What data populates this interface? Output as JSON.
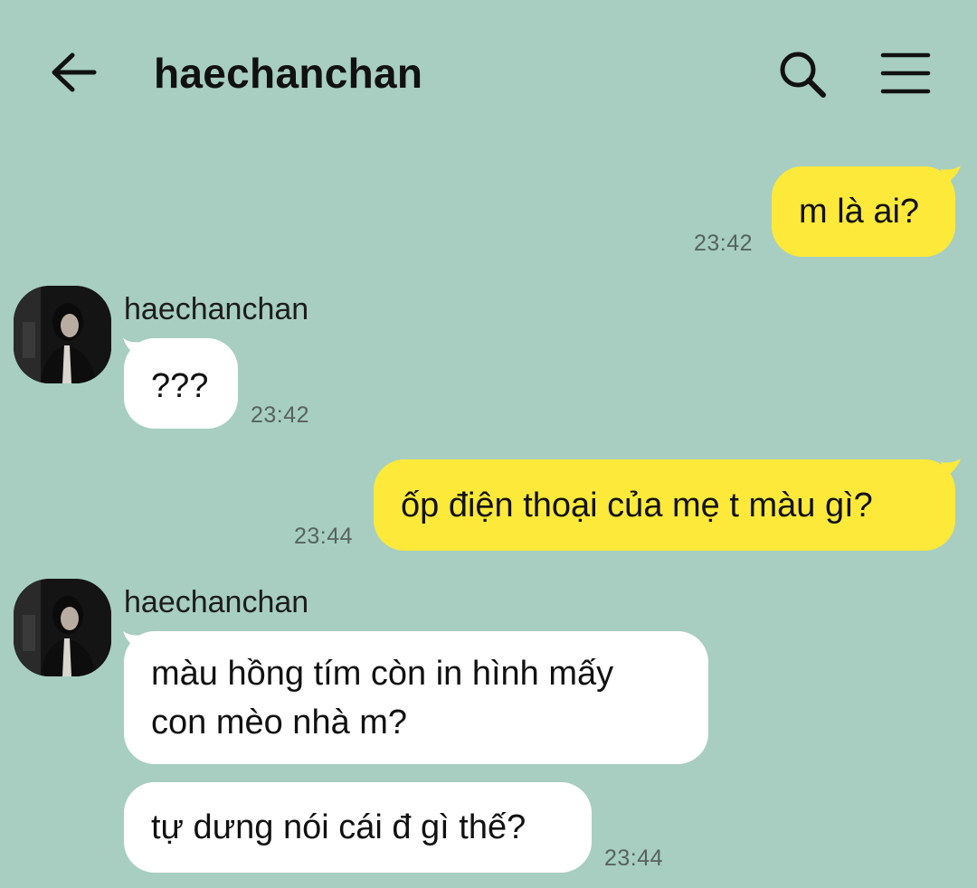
{
  "header": {
    "title": "haechanchan",
    "back_icon": "arrow-left-icon",
    "search_icon": "search-icon",
    "menu_icon": "hamburger-menu-icon"
  },
  "colors": {
    "background": "#a7cec1",
    "my_bubble": "#fde93a",
    "their_bubble": "#ffffff",
    "timestamp": "#56635e"
  },
  "messages": [
    {
      "from": "me",
      "text": "m là ai?",
      "time": "23:42"
    },
    {
      "from": "haechanchan",
      "sender": "haechanchan",
      "text": "???",
      "time": "23:42"
    },
    {
      "from": "me",
      "text": "ốp điện thoại của mẹ t màu gì?",
      "time": "23:44"
    },
    {
      "from": "haechanchan",
      "sender": "haechanchan",
      "lines": [
        "màu hồng tím còn in hình mấy",
        "con mèo nhà m?"
      ]
    },
    {
      "from": "haechanchan",
      "text": "tự dưng nói cái đ gì thế?",
      "time": "23:44"
    }
  ]
}
